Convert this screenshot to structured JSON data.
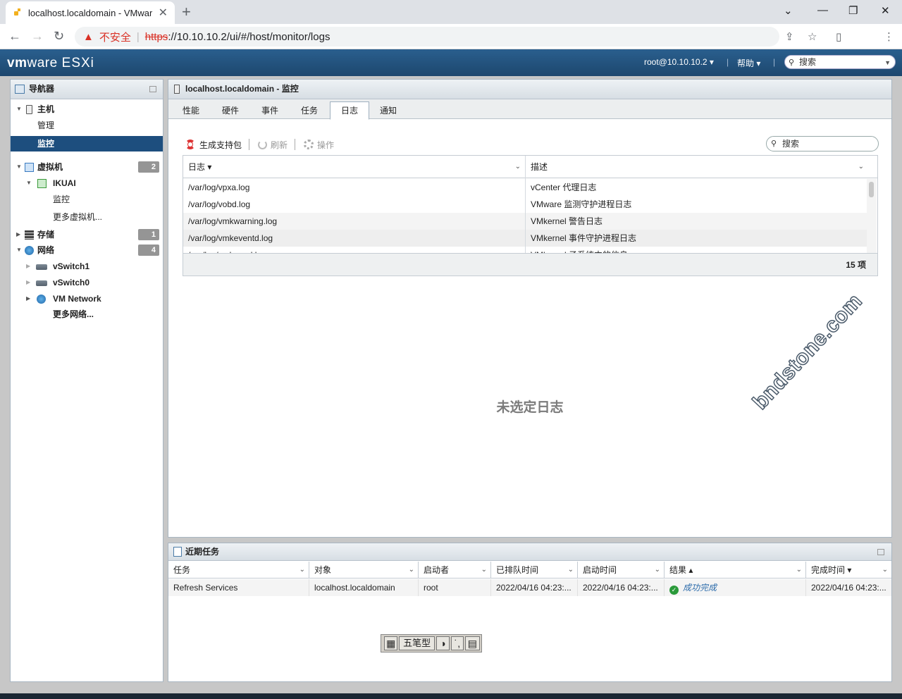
{
  "browser": {
    "tab_title": "localhost.localdomain - VMware ESXi",
    "new_tab": "+",
    "security_label": "不安全",
    "url_scheme": "https",
    "url_rest": "://10.10.10.2/ui/#/host/monitor/logs"
  },
  "esxi_header": {
    "logo_vm": "vm",
    "logo_ware": "ware",
    "logo_product": "ESXi",
    "user": "root@10.10.10.2 ▾",
    "help": "帮助 ▾",
    "search_placeholder": "搜索"
  },
  "navigator": {
    "title": "导航器",
    "items": [
      {
        "label": "主机"
      },
      {
        "label": "管理"
      },
      {
        "label": "监控"
      },
      {
        "label": "虚拟机",
        "badge": "2"
      },
      {
        "label": "IKUAI"
      },
      {
        "label": "监控"
      },
      {
        "label": "更多虚拟机..."
      },
      {
        "label": "存储",
        "badge": "1"
      },
      {
        "label": "网络",
        "badge": "4"
      },
      {
        "label": "vSwitch1"
      },
      {
        "label": "vSwitch0"
      },
      {
        "label": "VM Network"
      },
      {
        "label": "更多网络..."
      }
    ]
  },
  "content": {
    "title": "localhost.localdomain - 监控",
    "tabs": [
      "性能",
      "硬件",
      "事件",
      "任务",
      "日志",
      "通知"
    ],
    "active_tab": "日志",
    "toolbar": {
      "generate": "生成支持包",
      "refresh": "刷新",
      "actions": "操作"
    },
    "search_placeholder": "搜索",
    "grid": {
      "col_log": "日志 ▾",
      "col_desc": "描述",
      "rows": [
        {
          "log": "/var/log/vpxa.log",
          "desc": "vCenter 代理日志"
        },
        {
          "log": "/var/log/vobd.log",
          "desc": "VMware 监测守护进程日志"
        },
        {
          "log": "/var/log/vmkwarning.log",
          "desc": "VMkernel 警告日志"
        },
        {
          "log": "/var/log/vmkeventd.log",
          "desc": "VMkernel 事件守护进程日志"
        },
        {
          "log": "/var/log/vmkernel.log",
          "desc": "VMkernel 子系统中的信息"
        }
      ],
      "count": "15 项"
    },
    "no_selection": "未选定日志",
    "watermark": "bndstone.com"
  },
  "recent_tasks": {
    "title": "近期任务",
    "columns": [
      "任务",
      "对象",
      "启动者",
      "已排队时间",
      "启动时间",
      "结果 ▴",
      "完成时间 ▾"
    ],
    "rows": [
      {
        "task": "Refresh Services",
        "object": "localhost.localdomain",
        "initiator": "root",
        "queued": "2022/04/16 04:23:...",
        "started": "2022/04/16 04:23:...",
        "result": "成功完成",
        "completed": "2022/04/16 04:23:..."
      }
    ]
  },
  "ime": {
    "mode": "五笔型"
  },
  "colors": {
    "header": "#1d476e",
    "selected_nav": "#1d4e7e",
    "success": "#2a9a3a"
  }
}
